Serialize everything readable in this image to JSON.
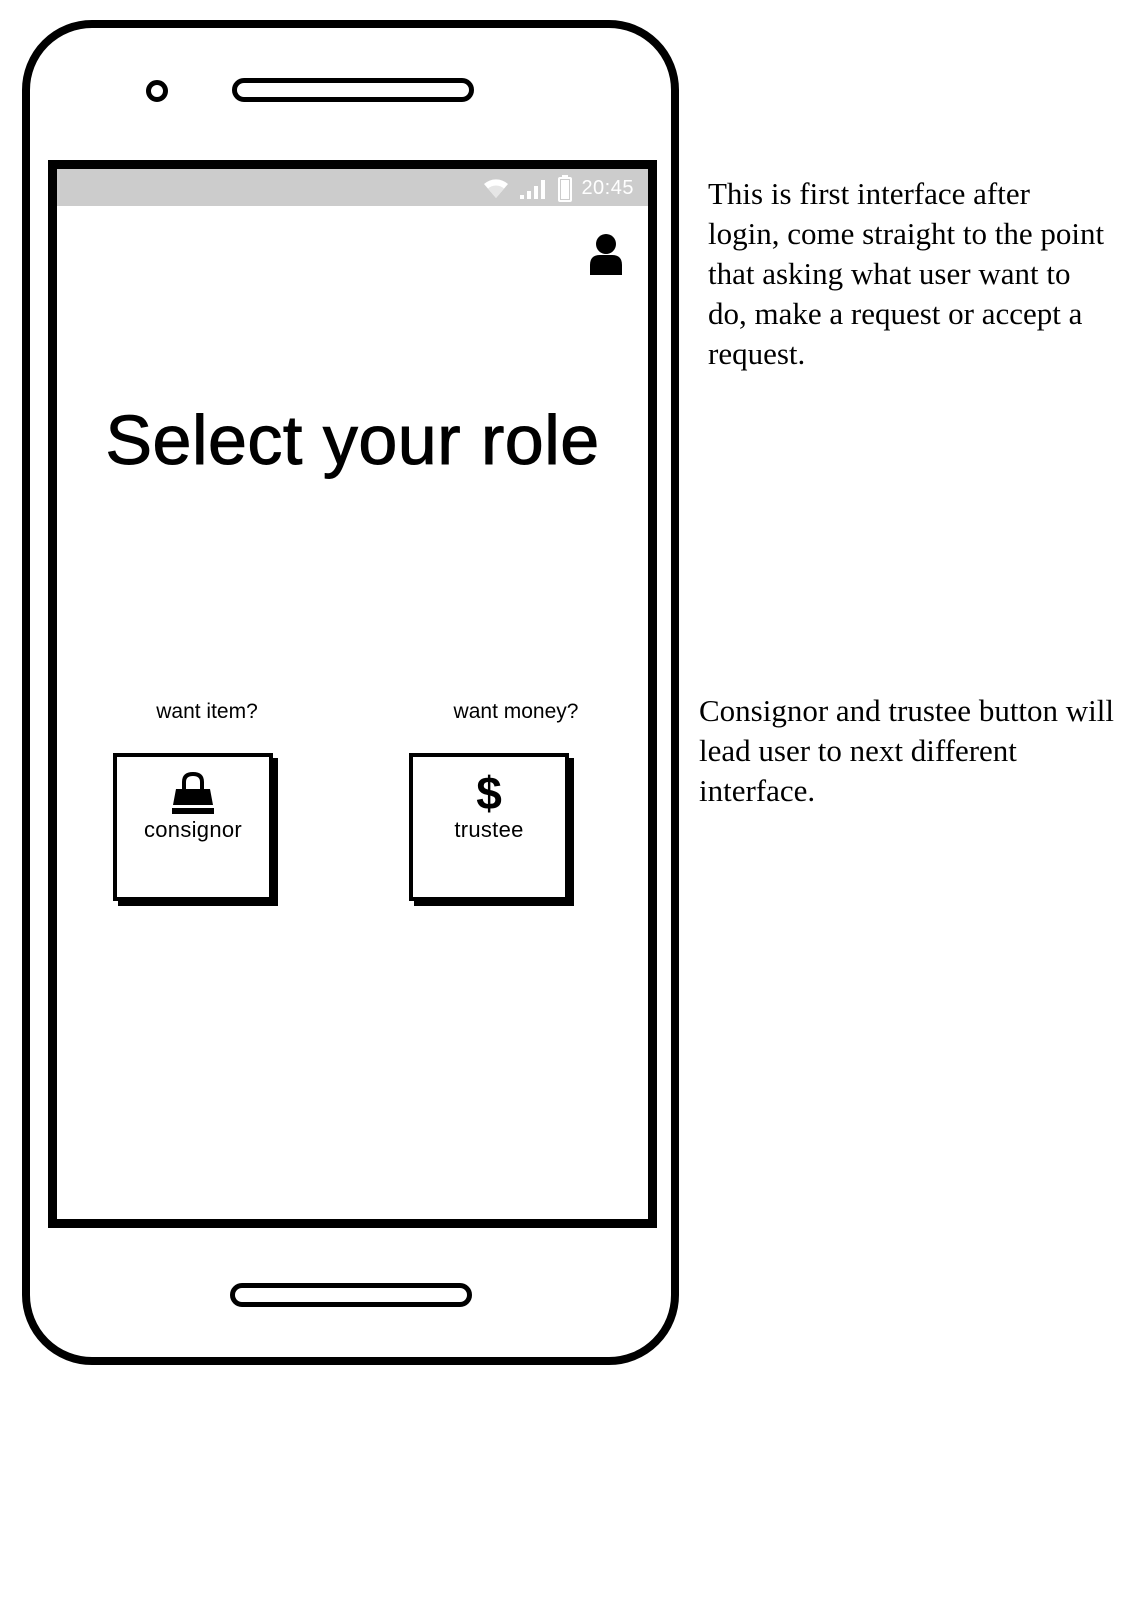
{
  "status_bar": {
    "time": "20:45",
    "icons": [
      "wifi-icon",
      "signal-icon",
      "battery-icon"
    ]
  },
  "header": {
    "profile_icon": "user-icon"
  },
  "main": {
    "title": "Select your role",
    "roles": [
      {
        "question": "want item?",
        "label": "consignor",
        "icon": "shopping-bag-icon"
      },
      {
        "question": "want money?",
        "label": "trustee",
        "icon": "dollar-icon"
      }
    ]
  },
  "annotations": [
    "This is first interface after login, come straight to the point that asking what user want to do, make a request or accept a request.",
    "Consignor and trustee button will lead user to next different interface."
  ],
  "colors": {
    "status_bar": "#cccccc",
    "stroke": "#000000",
    "status_text": "#ffffff"
  }
}
